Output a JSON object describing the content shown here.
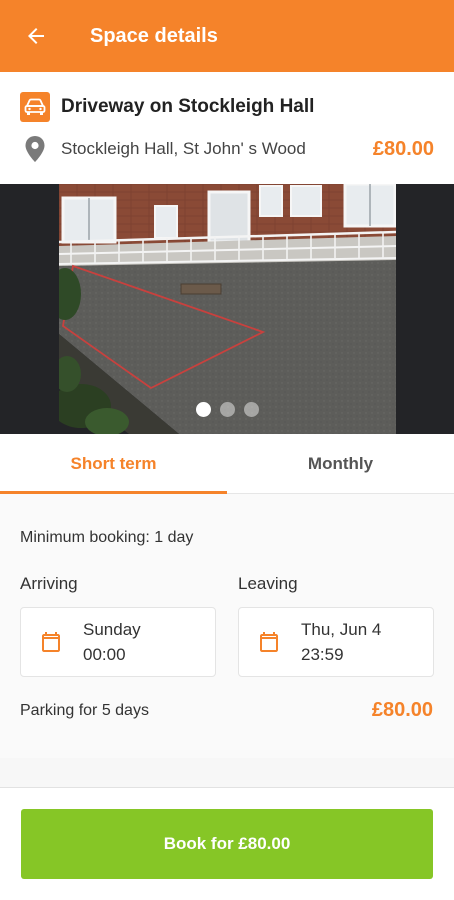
{
  "appbar": {
    "title": "Space details",
    "back_icon": "arrow-left-icon",
    "background": "#f5832a"
  },
  "listing": {
    "title": "Driveway on Stockleigh Hall",
    "address": "Stockleigh Hall, St John' s Wood",
    "price": "£80.00",
    "type_icon": "car-icon",
    "location_icon": "map-pin-icon"
  },
  "gallery": {
    "photo_count": 3,
    "current_index": 0
  },
  "tabs": [
    {
      "label": "Short term",
      "active": true
    },
    {
      "label": "Monthly",
      "active": false
    }
  ],
  "booking": {
    "minimum": "Minimum booking: 1 day",
    "arriving": {
      "label": "Arriving",
      "day": "Sunday",
      "time": "00:00"
    },
    "leaving": {
      "label": "Leaving",
      "day": "Thu, Jun 4",
      "time": "23:59"
    },
    "duration": "Parking for 5 days",
    "total": "£80.00",
    "calendar_icon": "calendar-icon"
  },
  "cta": {
    "label": "Book for £80.00",
    "color": "#86c626"
  },
  "colors": {
    "accent": "#f5832a",
    "action": "#86c626"
  }
}
